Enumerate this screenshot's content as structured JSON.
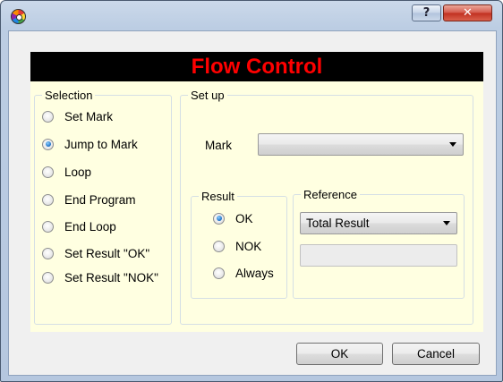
{
  "window": {
    "help_glyph": "?",
    "close_glyph": "✕"
  },
  "banner": {
    "title": "Flow Control",
    "title_color": "#ff0000",
    "background_color": "#000000"
  },
  "panel_color": "#ffffe1",
  "selection": {
    "title": "Selection",
    "options": [
      {
        "label": "Set Mark",
        "checked": false
      },
      {
        "label": "Jump to Mark",
        "checked": true
      },
      {
        "label": "Loop",
        "checked": false
      },
      {
        "label": "End Program",
        "checked": false
      },
      {
        "label": "End Loop",
        "checked": false
      },
      {
        "label": "Set Result \"OK\"",
        "checked": false
      },
      {
        "label": "Set Result \"NOK\"",
        "checked": false
      }
    ]
  },
  "setup": {
    "title": "Set up",
    "mark_label": "Mark",
    "mark_value": "",
    "result": {
      "title": "Result",
      "options": [
        {
          "label": "OK",
          "checked": true
        },
        {
          "label": "NOK",
          "checked": false
        },
        {
          "label": "Always",
          "checked": false
        }
      ]
    },
    "reference": {
      "title": "Reference",
      "selected": "Total Result",
      "text_value": ""
    }
  },
  "buttons": {
    "ok": "OK",
    "cancel": "Cancel"
  }
}
